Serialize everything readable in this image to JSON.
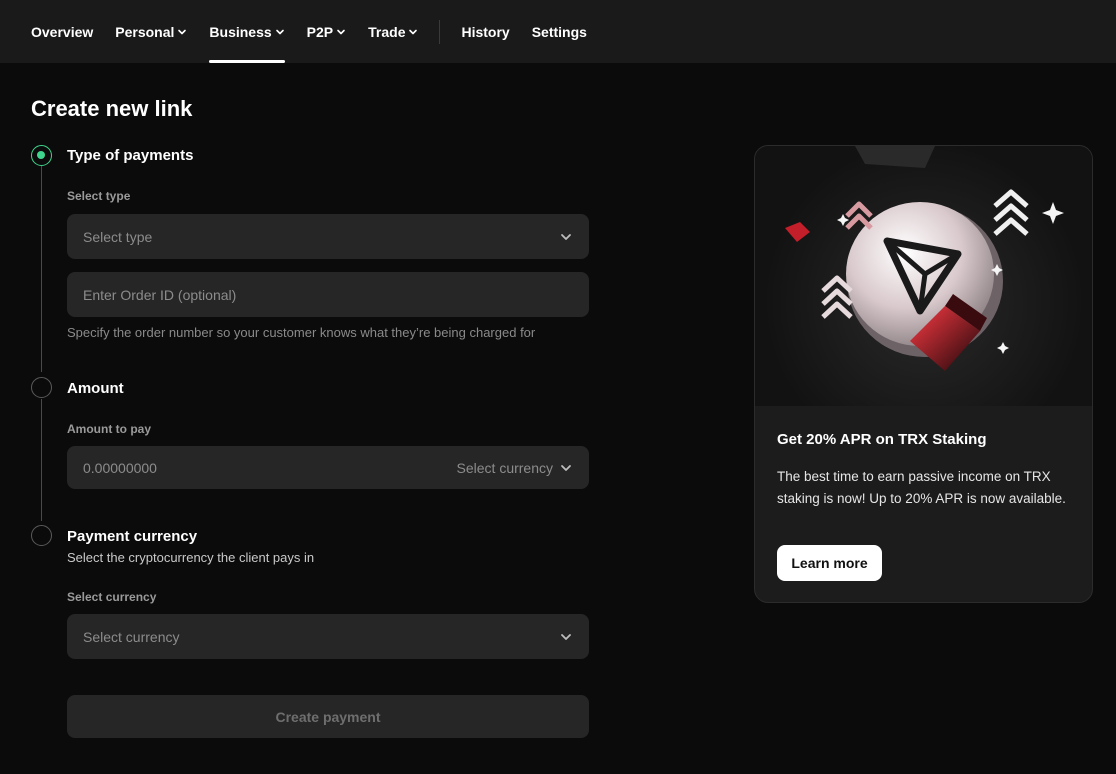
{
  "nav": {
    "items": [
      {
        "label": "Overview",
        "dropdown": false,
        "active": false
      },
      {
        "label": "Personal",
        "dropdown": true,
        "active": false
      },
      {
        "label": "Business",
        "dropdown": true,
        "active": true
      },
      {
        "label": "P2P",
        "dropdown": true,
        "active": false
      },
      {
        "label": "Trade",
        "dropdown": true,
        "active": false
      }
    ],
    "secondary": [
      {
        "label": "History"
      },
      {
        "label": "Settings"
      }
    ]
  },
  "page": {
    "title": "Create new link"
  },
  "steps": {
    "type": {
      "title": "Type of payments",
      "select_label": "Select type",
      "select_placeholder": "Select type",
      "order_placeholder": "Enter Order ID (optional)",
      "order_helper": "Specify the order number so your customer knows what they’re being charged for"
    },
    "amount": {
      "title": "Amount",
      "label": "Amount to pay",
      "placeholder": "0.00000000",
      "currency_placeholder": "Select currency"
    },
    "currency": {
      "title": "Payment currency",
      "subtitle": "Select the cryptocurrency the client pays in",
      "label": "Select currency",
      "placeholder": "Select currency"
    }
  },
  "actions": {
    "create_label": "Create payment"
  },
  "promo": {
    "title": "Get 20% APR on TRX Staking",
    "text": "The best time to earn passive income on TRX staking is now! Up to 20% APR is now available.",
    "button_label": "Learn more",
    "image_icon": "tron-coin-icon"
  },
  "colors": {
    "accent_green": "#3dd68c",
    "background": "#0b0b0b",
    "nav_bg": "#1a1a1a",
    "field_bg": "#262626",
    "promo_red": "#e0313a"
  }
}
